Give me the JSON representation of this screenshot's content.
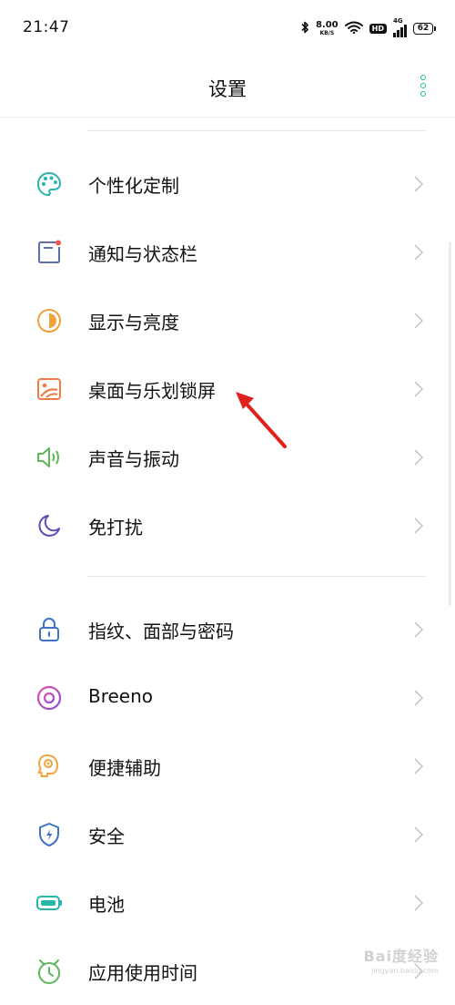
{
  "status_bar": {
    "time": "21:47",
    "net_speed_value": "8.00",
    "net_speed_unit": "KB/S",
    "hd_badge": "HD",
    "network_type": "4G",
    "battery_level": "62"
  },
  "header": {
    "title": "设置"
  },
  "groups": [
    {
      "items": [
        {
          "label": "个性化定制",
          "icon": "palette-icon"
        },
        {
          "label": "通知与状态栏",
          "icon": "notification-icon"
        },
        {
          "label": "显示与亮度",
          "icon": "brightness-icon"
        },
        {
          "label": "桌面与乐划锁屏",
          "icon": "wallpaper-icon"
        },
        {
          "label": "声音与振动",
          "icon": "speaker-icon"
        },
        {
          "label": "免打扰",
          "icon": "moon-icon"
        }
      ]
    },
    {
      "items": [
        {
          "label": "指纹、面部与密码",
          "icon": "lock-icon"
        },
        {
          "label": "Breeno",
          "icon": "breeno-icon"
        },
        {
          "label": "便捷辅助",
          "icon": "assist-icon"
        },
        {
          "label": "安全",
          "icon": "shield-icon"
        },
        {
          "label": "电池",
          "icon": "battery-icon"
        },
        {
          "label": "应用使用时间",
          "icon": "app-timer-icon"
        }
      ]
    }
  ],
  "colors": {
    "accent": "#1fbf85",
    "annotation_arrow": "#e0221d"
  },
  "watermark": {
    "main": "Bai度经验",
    "sub": "jingyan.baidu.com"
  }
}
